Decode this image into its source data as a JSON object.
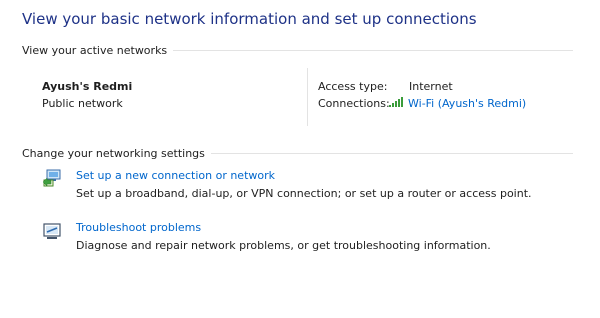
{
  "title": "View your basic network information and set up connections",
  "active_networks": {
    "heading": "View your active networks",
    "network_name": "Ayush's Redmi",
    "network_type": "Public network",
    "access_type_label": "Access type:",
    "access_type_value": "Internet",
    "connections_label": "Connections:",
    "connection_link": "Wi-Fi (Ayush's Redmi)",
    "connection_icon": "wifi-signal-icon"
  },
  "settings": {
    "heading": "Change your networking settings",
    "items": [
      {
        "icon": "network-setup-icon",
        "link": "Set up a new connection or network",
        "description": "Set up a broadband, dial-up, or VPN connection; or set up a router or access point."
      },
      {
        "icon": "troubleshoot-icon",
        "link": "Troubleshoot problems",
        "description": "Diagnose and repair network problems, or get troubleshooting information."
      }
    ]
  },
  "colors": {
    "title": "#1e3287",
    "link": "#0066cc",
    "divider": "#e3e3e3",
    "wifi": "#3a9c3a"
  }
}
